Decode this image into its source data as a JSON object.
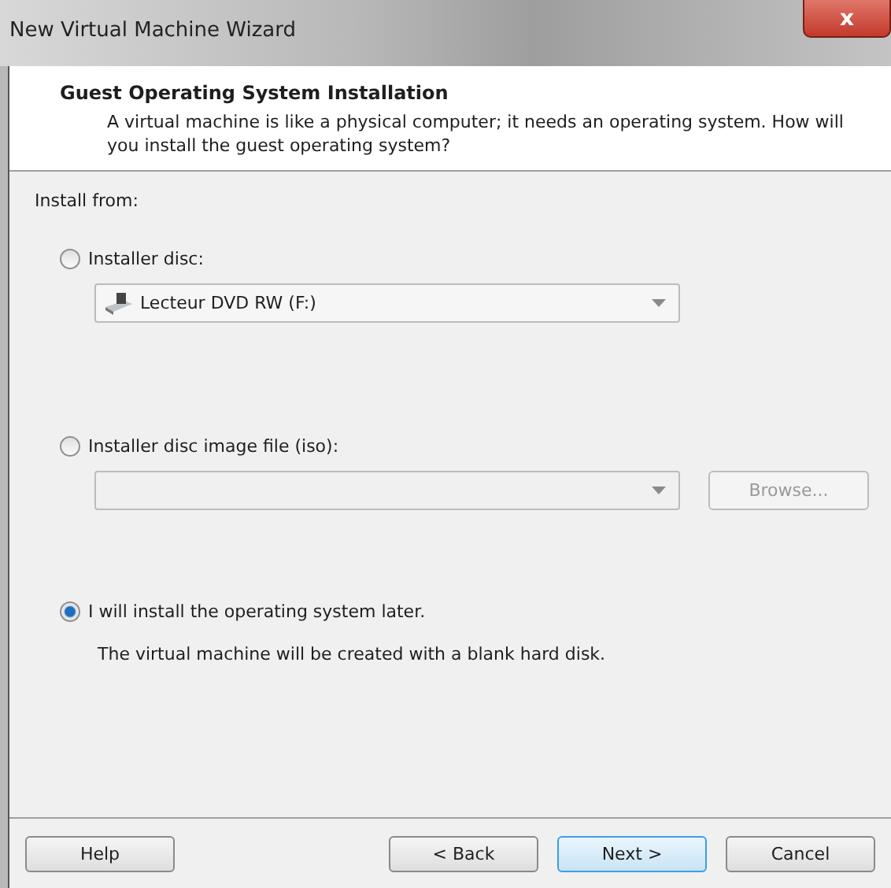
{
  "window": {
    "title": "New Virtual Machine Wizard",
    "close": "x"
  },
  "header": {
    "title": "Guest Operating System Installation",
    "description": "A virtual machine is like a physical computer; it needs an operating system. How will you install the guest operating system?"
  },
  "install_from": "Install from:",
  "options": [
    {
      "kind": "drive",
      "label": "Installer disc:",
      "selected": false,
      "value": "Lecteur DVD RW (F:)"
    },
    {
      "kind": "file",
      "label": "Installer disc image file (iso):",
      "selected": false,
      "browse": {
        "label": "Browse...",
        "disabled": true
      }
    },
    {
      "kind": "later",
      "label": "I will install the operating system later.",
      "selected": true,
      "note": "The virtual machine will be created with a blank hard disk."
    }
  ],
  "buttons": [
    {
      "label": "Help",
      "default": false
    },
    {
      "label": "< Back",
      "default": false
    },
    {
      "label": "Next >",
      "default": true
    },
    {
      "label": "Cancel",
      "default": false
    }
  ]
}
